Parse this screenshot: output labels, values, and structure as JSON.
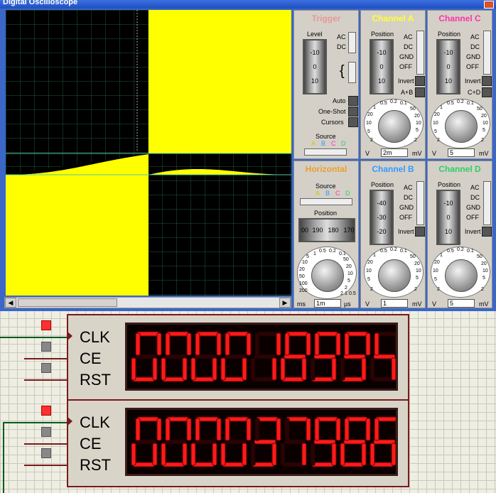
{
  "window": {
    "title": "Digital Oscilloscope"
  },
  "colors": {
    "trace_yellow": "#ffff00",
    "trace_green": "#50c8a0",
    "display_red": "#ff1a1a",
    "chA": "#ffff33",
    "chB": "#3399ff",
    "chC": "#ff33aa",
    "chD": "#33cc66",
    "trigger": "#e89898",
    "horizontal": "#e8a030"
  },
  "trigger": {
    "title": "Trigger",
    "level_label": "Level",
    "level_ticks": [
      "-10",
      "0",
      "10"
    ],
    "ac": "AC",
    "dc": "DC",
    "auto": "Auto",
    "one_shot": "One-Shot",
    "cursors": "Cursors",
    "source_label": "Source",
    "sources": [
      "A",
      "B",
      "C",
      "D"
    ]
  },
  "channel_a": {
    "title": "Channel A",
    "position_label": "Position",
    "ticks": [
      "-10",
      "0",
      "10"
    ],
    "modes": [
      "AC",
      "DC",
      "GND",
      "OFF"
    ],
    "invert": "Invert",
    "extra": "A+B",
    "scale": [
      "0.5",
      "0.2",
      "0.1",
      "50",
      "20",
      "10",
      "5",
      "2",
      "1",
      "20",
      "10",
      "5",
      "2"
    ],
    "unit_left": "V",
    "value": "2m",
    "unit_right": "mV"
  },
  "channel_b": {
    "title": "Channel B",
    "position_label": "Position",
    "ticks": [
      "-40",
      "-30",
      "-20"
    ],
    "modes": [
      "AC",
      "DC",
      "GND",
      "OFF"
    ],
    "invert": "Invert",
    "scale": [
      "0.5",
      "0.2",
      "0.1",
      "50",
      "20",
      "10",
      "5",
      "2",
      "1",
      "20",
      "10",
      "5",
      "2"
    ],
    "unit_left": "V",
    "value": "1",
    "unit_right": "mV"
  },
  "channel_c": {
    "title": "Channel C",
    "position_label": "Position",
    "ticks": [
      "-10",
      "0",
      "10"
    ],
    "modes": [
      "AC",
      "DC",
      "GND",
      "OFF"
    ],
    "invert": "Invert",
    "extra": "C+D",
    "scale": [
      "0.5",
      "0.2",
      "0.1",
      "50",
      "20",
      "10",
      "5",
      "2",
      "1",
      "20",
      "10",
      "5",
      "2"
    ],
    "unit_left": "V",
    "value": "5",
    "unit_right": "mV"
  },
  "channel_d": {
    "title": "Channel D",
    "position_label": "Position",
    "ticks": [
      "-10",
      "0",
      "10"
    ],
    "modes": [
      "AC",
      "DC",
      "GND",
      "OFF"
    ],
    "invert": "Invert",
    "scale": [
      "0.5",
      "0.2",
      "0.1",
      "50",
      "20",
      "10",
      "5",
      "2",
      "1",
      "20",
      "10",
      "5",
      "2"
    ],
    "unit_left": "V",
    "value": "5",
    "unit_right": "mV"
  },
  "horizontal": {
    "title": "Horizontal",
    "source_label": "Source",
    "sources": [
      "A",
      "B",
      "C",
      "D"
    ],
    "position_label": "Position",
    "ticks": [
      "00",
      "190",
      "180",
      "170"
    ],
    "scale": [
      "0.5",
      "0.2",
      "0.1",
      "50",
      "20",
      "10",
      "5",
      "2",
      "1",
      "200",
      "100",
      "50",
      "20",
      "10",
      "5",
      "2",
      "1",
      "0.5"
    ],
    "unit_left": "ms",
    "value": "1m",
    "unit_right": "µs"
  },
  "counters": [
    {
      "pins": [
        "CLK",
        "CE",
        "RST"
      ],
      "digits": [
        "0",
        "0",
        "0",
        "0",
        "1",
        "8",
        "9",
        "9",
        "4"
      ]
    },
    {
      "pins": [
        "CLK",
        "CE",
        "RST"
      ],
      "digits": [
        "0",
        "0",
        "0",
        "0",
        "3",
        "7",
        "9",
        "8",
        "8"
      ]
    }
  ]
}
